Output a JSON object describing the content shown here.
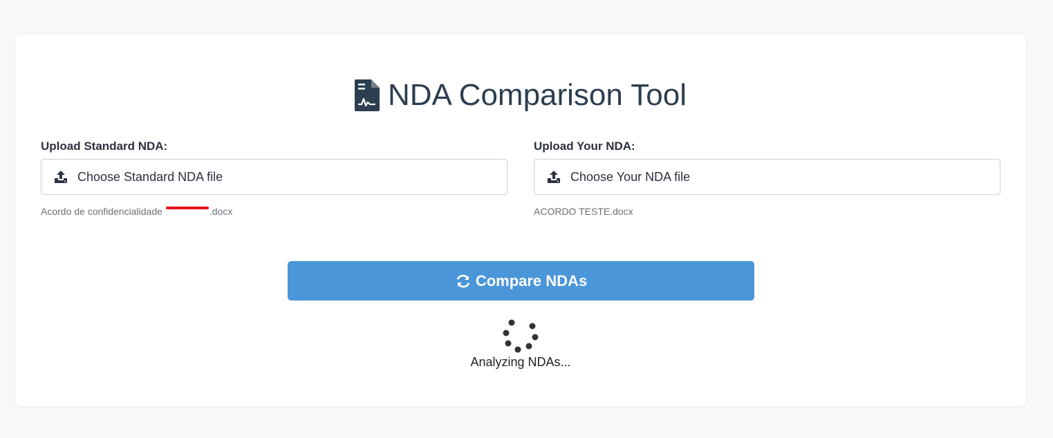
{
  "header": {
    "title": "NDA Comparison Tool",
    "icon": "file-contract-icon"
  },
  "standard_upload": {
    "label": "Upload Standard NDA:",
    "button_text": "Choose Standard NDA file",
    "file_name_prefix": "Acordo de confidencialidade",
    "file_name_suffix": ".docx",
    "icon": "upload-icon"
  },
  "your_upload": {
    "label": "Upload Your NDA:",
    "button_text": "Choose Your NDA file",
    "file_name": "ACORDO TESTE.docx",
    "icon": "upload-icon"
  },
  "compare_button": {
    "label": "Compare NDAs",
    "icon": "sync-icon",
    "color": "#4a96d9"
  },
  "loading": {
    "text": "Analyzing NDAs...",
    "icon": "spinner-icon"
  },
  "colors": {
    "background": "#f7f8fa",
    "card": "#ffffff",
    "title": "#2c3e50",
    "redaction": "#e8101a"
  }
}
